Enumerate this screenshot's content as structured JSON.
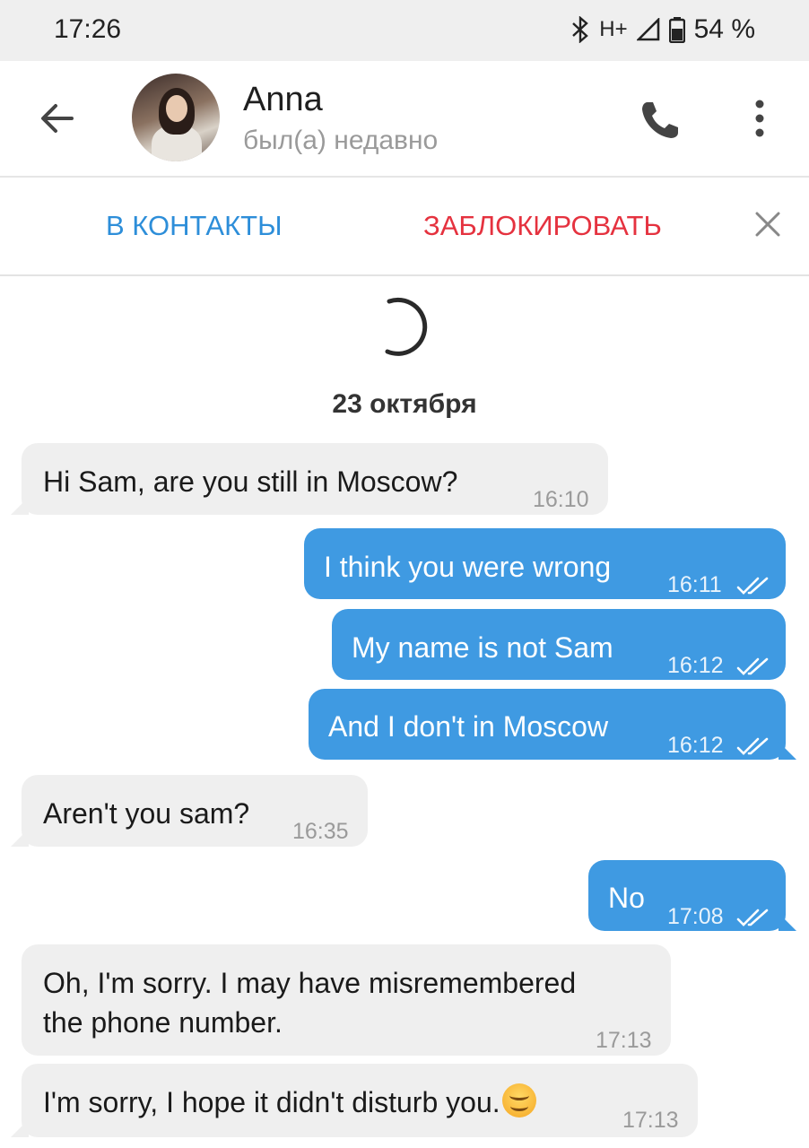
{
  "status_bar": {
    "time": "17:26",
    "network": "H+",
    "battery": "54 %"
  },
  "header": {
    "contact_name": "Anna",
    "contact_status": "был(а) недавно"
  },
  "actions": {
    "add_contact": "В КОНТАКТЫ",
    "block": "ЗАБЛОКИРОВАТЬ"
  },
  "chat": {
    "date": "23 октября",
    "messages": [
      {
        "direction": "in",
        "text": "Hi Sam, are you still in Moscow?",
        "time": "16:10"
      },
      {
        "direction": "out",
        "text": "I think you were wrong",
        "time": "16:11",
        "read": true
      },
      {
        "direction": "out",
        "text": "My name is not Sam",
        "time": "16:12",
        "read": true
      },
      {
        "direction": "out",
        "text": "And I don't in Moscow",
        "time": "16:12",
        "read": true
      },
      {
        "direction": "in",
        "text": "Aren't you sam?",
        "time": "16:35"
      },
      {
        "direction": "out",
        "text": "No",
        "time": "17:08",
        "read": true
      },
      {
        "direction": "in",
        "text_line1": "Oh, I'm sorry. I may have misremembered",
        "text_line2": "the phone number.",
        "time": "17:13"
      },
      {
        "direction": "in",
        "text": "I'm sorry, I hope it didn't disturb you.",
        "emoji": "smiling-face",
        "time": "17:13"
      }
    ]
  },
  "colors": {
    "accent": "#2d8ed9",
    "danger": "#e5323f",
    "outgoing_bubble": "#3f9ae2",
    "incoming_bubble": "#efefef"
  },
  "icons": [
    "bluetooth-icon",
    "signal-icon",
    "battery-icon",
    "back-arrow-icon",
    "phone-icon",
    "more-vert-icon",
    "close-icon",
    "loading-spinner-icon",
    "double-check-icon",
    "smiling-emoji-icon"
  ]
}
